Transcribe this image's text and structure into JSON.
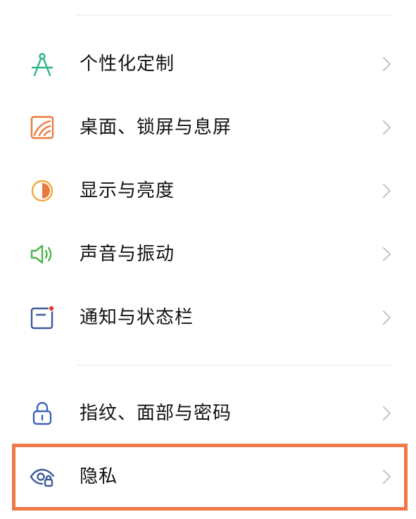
{
  "settings": {
    "items": [
      {
        "label": "个性化定制",
        "icon": "compass-icon",
        "icon_color": "#2fb58a"
      },
      {
        "label": "桌面、锁屏与息屏",
        "icon": "wallpaper-icon",
        "icon_color": "#e87a3e"
      },
      {
        "label": "显示与亮度",
        "icon": "brightness-icon",
        "icon_color": "#f1a93a"
      },
      {
        "label": "声音与振动",
        "icon": "speaker-icon",
        "icon_color": "#4cb54c"
      },
      {
        "label": "通知与状态栏",
        "icon": "notification-icon",
        "icon_color": "#3d5a99"
      },
      {
        "label": "指纹、面部与密码",
        "icon": "lock-icon",
        "icon_color": "#3d64b8"
      },
      {
        "label": "隐私",
        "icon": "privacy-eye-icon",
        "icon_color": "#3d5a99"
      }
    ]
  },
  "colors": {
    "highlight_border": "#f07746",
    "divider": "#e6e6e6",
    "chevron": "#c4c4c4",
    "notification_dot": "#e53935"
  }
}
